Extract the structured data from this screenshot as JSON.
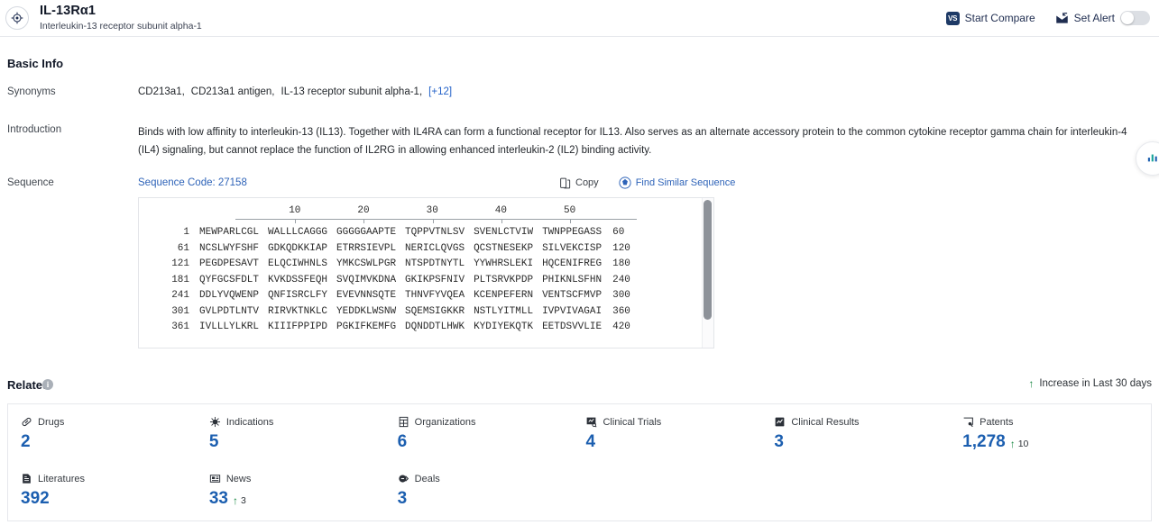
{
  "header": {
    "logo_icon": "target-crosshair-icon",
    "title": "IL-13Rα1",
    "subtitle": "Interleukin-13 receptor subunit alpha-1",
    "start_compare_label": "Start Compare",
    "start_compare_icon_text": "VS",
    "set_alert_label": "Set Alert",
    "set_alert_icon": "alert-mail-icon",
    "toggle_on": false
  },
  "basic_info": {
    "section_title": "Basic Info",
    "synonyms_label": "Synonyms",
    "synonyms": [
      "CD213a1,",
      "CD213a1 antigen,",
      "IL-13 receptor subunit alpha-1,"
    ],
    "synonyms_more": "[+12]",
    "introduction_label": "Introduction",
    "introduction_text": "Binds with low affinity to interleukin-13 (IL13). Together with IL4RA can form a functional receptor for IL13. Also serves as an alternate accessory protein to the common cytokine receptor gamma chain for interleukin-4 (IL4) signaling, but cannot replace the function of IL2RG in allowing enhanced interleukin-2 (IL2) binding activity.",
    "sequence_label": "Sequence",
    "sequence_code": "Sequence Code: 27158",
    "copy_label": "Copy",
    "copy_icon": "copy-icon",
    "find_similar_label": "Find Similar Sequence",
    "find_similar_icon": "find-similar-icon"
  },
  "sequence": {
    "ruler_ticks": [
      10,
      20,
      30,
      40,
      50
    ],
    "rows": [
      {
        "start": "1",
        "chunks": [
          "MEWPARLCGL",
          "WALLLCAGGG",
          "GGGGGAAPTE",
          "TQPPVTNLSV",
          "SVENLCTVIW",
          "TWNPPEGASS"
        ],
        "end": "60"
      },
      {
        "start": "61",
        "chunks": [
          "NCSLWYFSHF",
          "GDKQDKKIAP",
          "ETRRSIEVPL",
          "NERICLQVGS",
          "QCSTNESEKP",
          "SILVEKCISP"
        ],
        "end": "120"
      },
      {
        "start": "121",
        "chunks": [
          "PEGDPESAVT",
          "ELQCIWHNLS",
          "YMKCSWLPGR",
          "NTSPDTNYTL",
          "YYWHRSLEKI",
          "HQCENIFREG"
        ],
        "end": "180"
      },
      {
        "start": "181",
        "chunks": [
          "QYFGCSFDLT",
          "KVKDSSFEQH",
          "SVQIMVKDNA",
          "GKIKPSFNIV",
          "PLTSRVKPDP",
          "PHIKNLSFHN"
        ],
        "end": "240"
      },
      {
        "start": "241",
        "chunks": [
          "DDLYVQWENP",
          "QNFISRCLFY",
          "EVEVNNSQTE",
          "THNVFYVQEA",
          "KCENPEFERN",
          "VENTSCFMVP"
        ],
        "end": "300"
      },
      {
        "start": "301",
        "chunks": [
          "GVLPDTLNTV",
          "RIRVKTNKLC",
          "YEDDKLWSNW",
          "SQEMSIGKKR",
          "NSTLYITMLL",
          "IVPVIVAGAI"
        ],
        "end": "360"
      },
      {
        "start": "361",
        "chunks": [
          "IVLLLYLKRL",
          "KIIIFPPIPD",
          "PGKIFKEMFG",
          "DQNDDTLHWK",
          "KYDIYEKQTK",
          "EETDSVVLIE"
        ],
        "end": "420"
      }
    ]
  },
  "related": {
    "section_title": "Related",
    "info_icon_char": "i",
    "legend_label": "Increase in Last 30 days",
    "legend_arrow": "↑",
    "cards": [
      {
        "label": "Drugs",
        "icon": "pill-icon",
        "value": "2",
        "delta": null
      },
      {
        "label": "Indications",
        "icon": "virus-icon",
        "value": "5",
        "delta": null
      },
      {
        "label": "Organizations",
        "icon": "building-icon",
        "value": "6",
        "delta": null
      },
      {
        "label": "Clinical Trials",
        "icon": "clinical-trial-icon",
        "value": "4",
        "delta": null
      },
      {
        "label": "Clinical Results",
        "icon": "clinical-result-icon",
        "value": "3",
        "delta": null
      },
      {
        "label": "Patents",
        "icon": "patent-icon",
        "value": "1,278",
        "delta": "10"
      },
      {
        "label": "Literatures",
        "icon": "literature-icon",
        "value": "392",
        "delta": null
      },
      {
        "label": "News",
        "icon": "news-icon",
        "value": "33",
        "delta": "3"
      },
      {
        "label": "Deals",
        "icon": "deals-icon",
        "value": "3",
        "delta": null
      }
    ]
  },
  "float_widget": {
    "icon": "chat-assistant-icon"
  },
  "colors": {
    "accent_blue": "#1c5fb0",
    "link_blue": "#2e63b8",
    "increase_green": "#14853f"
  }
}
